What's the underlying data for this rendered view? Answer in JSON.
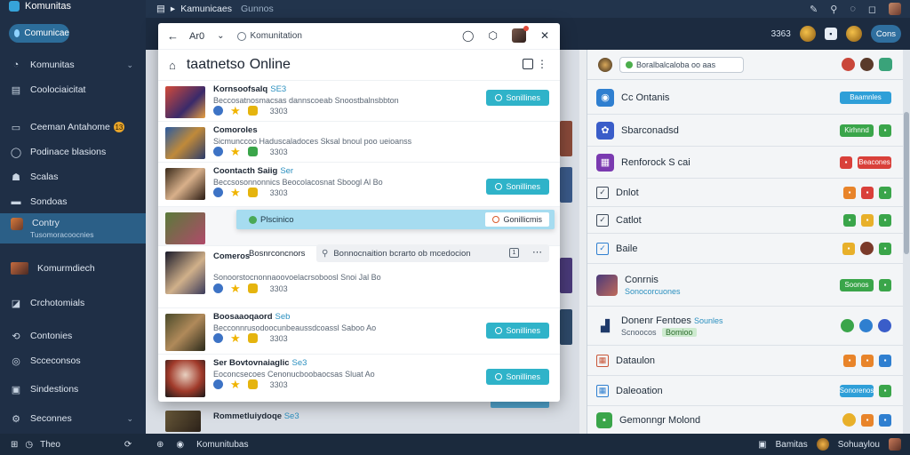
{
  "app": {
    "title": "Komunitas",
    "pill_label": "Comunicae"
  },
  "sidebar": {
    "items": [
      {
        "label": "Komunitas",
        "icon": "gauge-icon"
      },
      {
        "label": "Coolociaicitat",
        "icon": "list-icon"
      },
      {
        "label": "Ceeman Antahome",
        "icon": "notes-icon",
        "badge": "13"
      },
      {
        "label": "Podinace blasions",
        "icon": "chat-icon"
      },
      {
        "label": "Scalas",
        "icon": "people-icon"
      },
      {
        "label": "Sondoas",
        "icon": "bookmark-icon"
      },
      {
        "label": "Contry",
        "sub": "Tusomoracoocnies",
        "icon": "game-thumb-icon"
      },
      {
        "label": "Komurmdiech",
        "icon": "flag-icon"
      },
      {
        "label": "Crchotomials",
        "icon": "tag-icon"
      },
      {
        "label": "Contonies",
        "icon": "share-icon"
      },
      {
        "label": "Scceconsos",
        "icon": "settings-icon"
      },
      {
        "label": "Sindestions",
        "icon": "grid-icon"
      },
      {
        "label": "Seconnes",
        "icon": "gear-icon"
      }
    ]
  },
  "topbar": {
    "title": "Kamunicaes",
    "subtitle": "Gunnos"
  },
  "bar2": {
    "code": "3363",
    "button_label": "Cons"
  },
  "dialog": {
    "zoom": "Ar0",
    "address": "Komunitation",
    "title_main": "taatnetso",
    "title_sub": "Online",
    "games": [
      {
        "name": "Kornsoofsalq",
        "tag": "SE3",
        "desc": "Beccosatnosmacsas dannscoeab Snoostbalnsbbton",
        "count": "3303",
        "button": "Sonillines"
      },
      {
        "name": "Comoroles",
        "tag": "",
        "desc": "Sicmunccoo Haduscaladoces Sksal bnoul poo ueioanss",
        "count": "3303",
        "button": ""
      },
      {
        "name": "Coontacth Saiig",
        "tag": "Ser",
        "desc": "Beccsosonnonnics Beocolacosnat Sboogl Al Bo",
        "count": "3303",
        "button": "Sonillines"
      },
      {
        "name": "Comeros",
        "tag": "",
        "desc": "Sonoorstocnonnaoovoelacrsoboosl Snoi Jal Bo",
        "count": "3303",
        "button": ""
      },
      {
        "name": "Boosaaoqaord",
        "tag": "Seb",
        "desc": "Becconnrusodoocunbeaussdcoassl Saboo Ao",
        "count": "3303",
        "button": "Sonillines"
      },
      {
        "name": "Ser Bovtovnaiaglic",
        "tag": "Se3",
        "desc": "Eoconcsecoes Cenonucboobaocsas Sluat Ao",
        "count": "3303",
        "button": "Sonillines"
      }
    ],
    "overlay_label": "Plscinico",
    "overlay_button": "Gonillicmis",
    "search_label": "Bosnrconcnors",
    "search_placeholder": "Bonnocnaition bcrarto ob mcedocion",
    "bg_row_name": "Rommetluiydoqe",
    "bg_row_tag": "Se3"
  },
  "right_panel": {
    "header_chip": "Boralbalcaloba oo aas",
    "rows": [
      {
        "title": "Cc Ontanis",
        "sub": "",
        "actions": [
          "Baamnles"
        ]
      },
      {
        "title": "Sbarconadsd",
        "sub": "",
        "actions": [
          "Kirhnnd"
        ]
      },
      {
        "title": "Renforock S cai",
        "sub": "",
        "actions": [
          "Beacones"
        ]
      },
      {
        "title": "Dnlot",
        "sub": "",
        "actions": []
      },
      {
        "title": "Catlot",
        "sub": "",
        "actions": []
      },
      {
        "title": "Baile",
        "sub": "",
        "actions": []
      },
      {
        "title": "Conrnis",
        "sub": "Sonocorcuones",
        "actions": [
          "Soonos"
        ]
      },
      {
        "title": "Donenr Fentoes",
        "tag": "Sounles",
        "sub": "Scnoocos",
        "chip": "Bomioo",
        "actions": []
      },
      {
        "title": "Dataulon",
        "sub": "",
        "actions": []
      },
      {
        "title": "Daleoation",
        "sub": "",
        "actions": [
          "Sonorenos"
        ]
      },
      {
        "title": "Gemonngr Molond",
        "sub": "",
        "actions": []
      }
    ]
  },
  "bottombar": {
    "left_label": "Theo",
    "mid_label": "Komunitubas",
    "right_label": "Bamitas",
    "right_label2": "Sohuaylou"
  },
  "colors": {
    "sidebar_bg": "#1f2f46",
    "accent_cyan": "#2fb3c9",
    "accent_blue": "#2c6d9a"
  }
}
